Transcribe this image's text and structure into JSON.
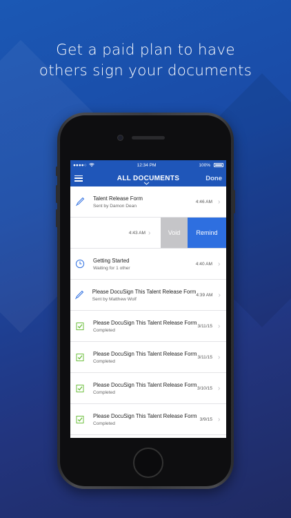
{
  "headline": {
    "line1": "Get a paid plan to have",
    "line2": "others sign your documents"
  },
  "status_bar": {
    "carrier": "●●●●○",
    "time": "12:34 PM",
    "battery": "100%"
  },
  "nav": {
    "title": "ALL DOCUMENTS",
    "done_label": "Done"
  },
  "documents": [
    {
      "title": "Talent Release Form",
      "subtitle": "Sent by Damon Dean",
      "time": "4:46 AM",
      "icon": "pen-icon"
    },
    {
      "time": "4:43 AM",
      "void_label": "Void",
      "remind_label": "Remind"
    },
    {
      "title": "Getting Started",
      "subtitle": "Waiting for 1 other",
      "time": "4:40 AM",
      "icon": "clock-icon"
    },
    {
      "title": "Please DocuSign This Talent Release Form",
      "subtitle": "Sent by Matthew Wolf",
      "time": "4:39 AM",
      "icon": "pen-icon"
    },
    {
      "title": "Please DocuSign This Talent Release Form",
      "subtitle": "Completed",
      "time": "3/11/15",
      "icon": "completed-icon"
    },
    {
      "title": "Please DocuSign This Talent Release Form",
      "subtitle": "Completed",
      "time": "3/11/15",
      "icon": "completed-icon"
    },
    {
      "title": "Please DocuSign This Talent Release Form",
      "subtitle": "Completed",
      "time": "3/10/15",
      "icon": "completed-icon"
    },
    {
      "title": "Please DocuSign This Talent Release Form",
      "subtitle": "Completed",
      "time": "3/9/15",
      "icon": "completed-icon"
    }
  ],
  "colors": {
    "nav_blue": "#1f56b9",
    "remind_blue": "#2e6fe0",
    "void_gray": "#c5c5c8",
    "completed_green": "#6cbf3c"
  }
}
